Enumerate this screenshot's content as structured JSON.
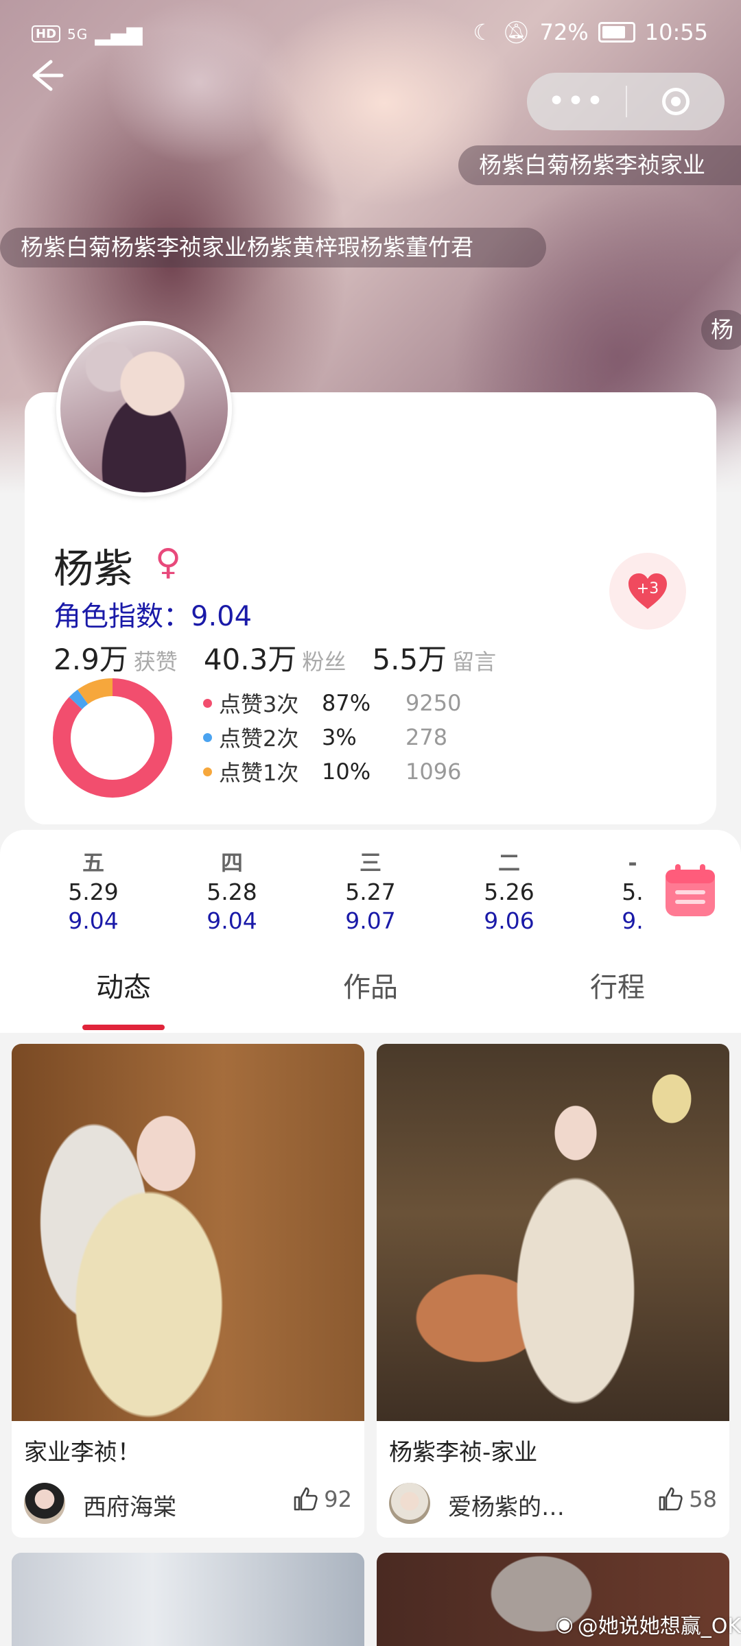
{
  "status_bar": {
    "hd": "HD",
    "signal": "5G",
    "battery": "72%",
    "time": "10:55"
  },
  "header": {
    "more_icon": "more-dots-icon",
    "target_icon": "mini-program-close-icon"
  },
  "danmu": [
    "杨紫白菊杨紫李祯家业",
    "杨紫白菊杨紫李祯家业杨紫黄梓瑕杨紫董竹君",
    "杨"
  ],
  "profile": {
    "name": "杨紫",
    "gender_symbol": "♀",
    "index_label": "角色指数：9.04",
    "stats": [
      {
        "value": "2.9万",
        "label": "获赞"
      },
      {
        "value": "40.3万",
        "label": "粉丝"
      },
      {
        "value": "5.5万",
        "label": "留言"
      }
    ],
    "heart_badge": "+3"
  },
  "chart_data": {
    "type": "pie",
    "series": [
      {
        "name": "点赞3次",
        "pct": "87%",
        "count": "9250",
        "color": "#f24e6e",
        "value": 87
      },
      {
        "name": "点赞2次",
        "pct": "3%",
        "count": "278",
        "color": "#4aa3f0",
        "value": 3
      },
      {
        "name": "点赞1次",
        "pct": "10%",
        "count": "1096",
        "color": "#f6a73c",
        "value": 10
      }
    ]
  },
  "dates": [
    {
      "weekday": "五",
      "date": "5.29",
      "value": "9.04"
    },
    {
      "weekday": "四",
      "date": "5.28",
      "value": "9.04"
    },
    {
      "weekday": "三",
      "date": "5.27",
      "value": "9.07"
    },
    {
      "weekday": "二",
      "date": "5.26",
      "value": "9.06"
    },
    {
      "weekday": "-",
      "date": "5.",
      "value": "9."
    }
  ],
  "tabs": [
    "动态",
    "作品",
    "行程"
  ],
  "posts": [
    {
      "title": "家业李祯！",
      "user": "西府海棠",
      "likes": "92"
    },
    {
      "title": "杨紫李祯-家业",
      "user": "爱杨紫的…",
      "likes": "58"
    }
  ],
  "watermark": "@她说她想赢_OK"
}
